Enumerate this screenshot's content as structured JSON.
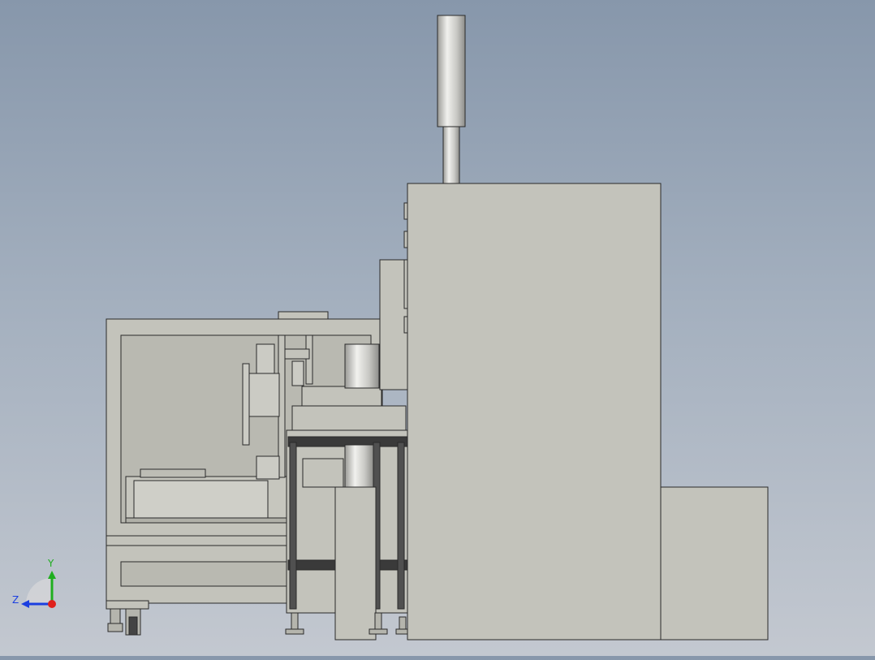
{
  "view": {
    "mode": "side-elevation"
  },
  "colors": {
    "body": "#c3c3bb",
    "edge": "#2a2a2a",
    "rod": "#d8d8d4",
    "axis_x": "#e0201c",
    "axis_y": "#1fae1f",
    "axis_z": "#1b3fe0"
  },
  "triad": {
    "y_label": "Y",
    "z_label": "Z"
  }
}
